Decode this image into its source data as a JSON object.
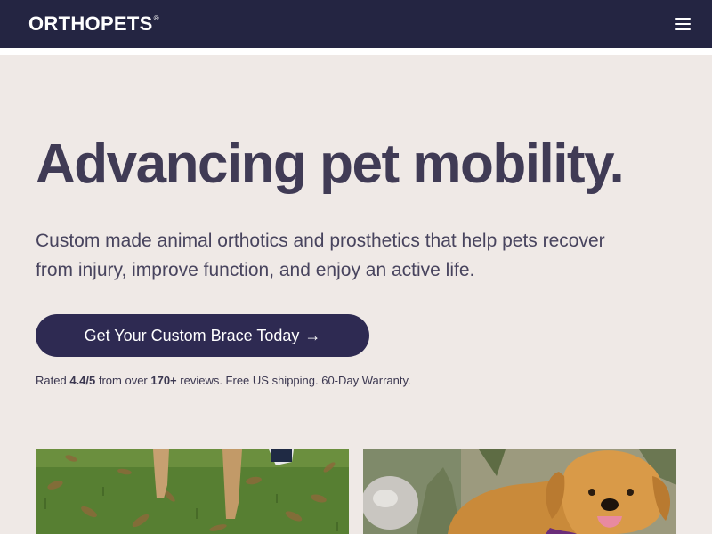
{
  "header": {
    "logo_text": "ORTHOPETS",
    "logo_mark": "®",
    "menu_icon": "hamburger-menu-icon"
  },
  "hero": {
    "headline": "Advancing pet mobility.",
    "subtext": "Custom made animal orthotics and prosthetics that help pets recover from injury, improve function, and enjoy an active life.",
    "cta_label": "Get Your Custom Brace Today",
    "cta_arrow": "→",
    "rating": {
      "prefix": "Rated ",
      "score": "4.4/5",
      "middle": " from over ",
      "count": "170+",
      "suffix": " reviews. Free US shipping. 60-Day Warranty."
    }
  },
  "colors": {
    "header_bg": "#242542",
    "page_bg": "#efe9e6",
    "cta_bg": "#2e2a52",
    "text": "#403b55"
  }
}
